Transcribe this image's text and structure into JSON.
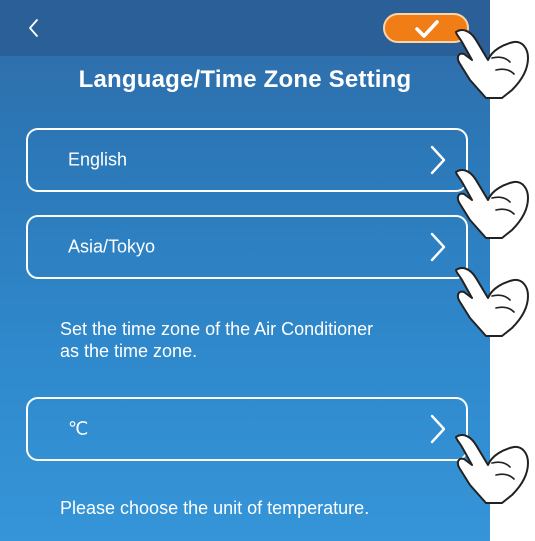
{
  "header": {
    "back_icon": "chevron-left-icon",
    "confirm_icon": "checkmark-icon",
    "accent_color": "#f07d16"
  },
  "title": "Language/Time Zone Setting",
  "settings": {
    "language": {
      "value": "English",
      "icon": "chevron-right-icon"
    },
    "timezone": {
      "value": "Asia/Tokyo",
      "icon": "chevron-right-icon"
    },
    "timezone_hint": [
      "Set the time zone of the Air Conditioner",
      "as the time zone."
    ],
    "temperature_unit": {
      "value": "℃",
      "icon": "chevron-right-icon"
    },
    "temperature_hint": "Please choose the unit of temperature."
  },
  "annotations": {
    "pointer_icon": "hand-pointer-icon"
  }
}
